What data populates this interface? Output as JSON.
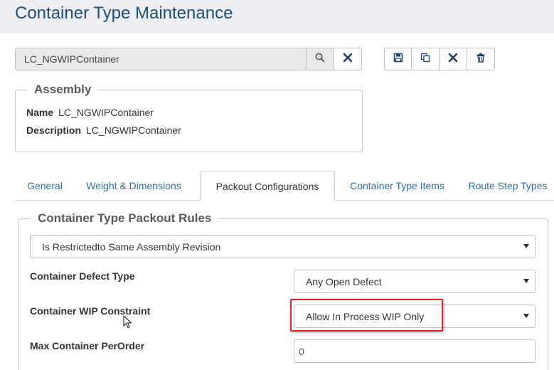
{
  "page": {
    "title": "Container Type Maintenance"
  },
  "search": {
    "value": "LC_NGWIPContainer"
  },
  "icons": {
    "search": "search-icon",
    "clear": "close-icon",
    "save": "save-icon",
    "copy": "copy-icon",
    "cancel": "close-icon",
    "delete": "trash-icon"
  },
  "assembly": {
    "legend": "Assembly",
    "name_label": "Name",
    "name_value": "LC_NGWIPContainer",
    "description_label": "Description",
    "description_value": "LC_NGWIPContainer"
  },
  "tabs": [
    {
      "label": "General",
      "active": false
    },
    {
      "label": "Weight & Dimensions",
      "active": false
    },
    {
      "label": "Packout Configurations",
      "active": true
    },
    {
      "label": "Container Type Items",
      "active": false
    },
    {
      "label": "Route Step Types",
      "active": false
    }
  ],
  "packout": {
    "legend": "Container Type Packout Rules",
    "revision_select": "Is Restrictedto Same Assembly Revision",
    "defect_label": "Container Defect Type",
    "defect_value": "Any Open Defect",
    "wip_label": "Container WIP Constraint",
    "wip_value": "Allow In Process WIP Only",
    "max_label": "Max Container PerOrder",
    "max_value": "0"
  },
  "colors": {
    "title": "#1f4e79",
    "link": "#2e6da4",
    "icon": "#1f3f66",
    "highlight": "#d9262c"
  }
}
